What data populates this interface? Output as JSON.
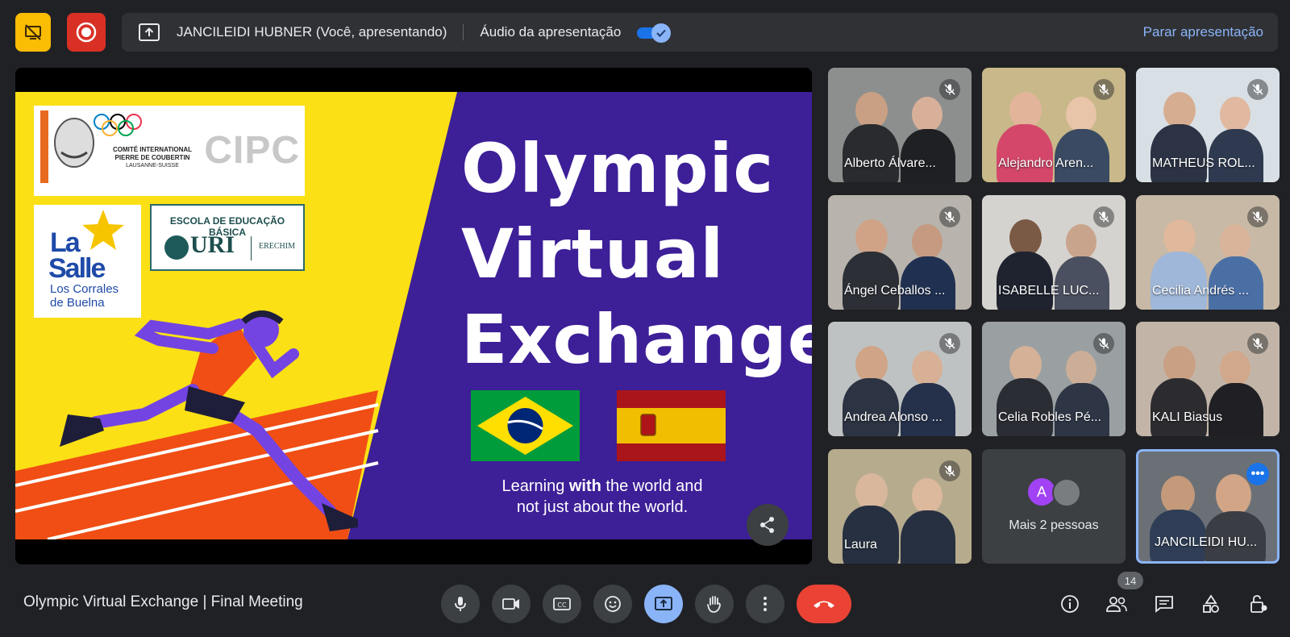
{
  "top_bar": {
    "stop_share_icon": "screen-share-off-icon",
    "record_icon": "record-icon",
    "presenter_text": "JANCILEIDI HUBNER (Você, apresentando)",
    "audio_label": "Áudio da apresentação",
    "audio_toggle_on": true,
    "stop_presenting_label": "Parar apresentação",
    "colors": {
      "stop_share_bg": "#fbbc04",
      "record_bg": "#d93025",
      "link": "#8ab4f8"
    }
  },
  "slide": {
    "title_lines": [
      "Olympic",
      "Virtual",
      "Exchange"
    ],
    "caption_pre": "Learning ",
    "caption_bold": "with",
    "caption_post": " the world and",
    "caption_line2": "not just about the world.",
    "cipc": {
      "letters": "CIPC",
      "line1": "COMITÉ INTERNATIONAL",
      "line2": "PIERRE DE COUBERTIN",
      "line3": "LAUSANNE-SUISSE"
    },
    "lasalle": {
      "la": "La",
      "salle": "Salle",
      "sub1": "Los Corrales",
      "sub2": "de Buelna"
    },
    "uri": {
      "school": "ESCOLA DE EDUCAÇÃO BÁSICA",
      "main": "URI",
      "city": "ERECHIM"
    },
    "colors": {
      "yellow": "#fbe016",
      "purple": "#3d1f97",
      "track": "#f04e14",
      "runner": "#7444e2"
    }
  },
  "participants": [
    {
      "name": "Alberto Álvare...",
      "muted": true
    },
    {
      "name": "Alejandro Aren...",
      "muted": true
    },
    {
      "name": "MATHEUS ROL...",
      "muted": true
    },
    {
      "name": "Ángel Ceballos ...",
      "muted": true
    },
    {
      "name": "ISABELLE LUC...",
      "muted": true
    },
    {
      "name": "Cecilia Andrés ...",
      "muted": true
    },
    {
      "name": "Andrea Alonso ...",
      "muted": true
    },
    {
      "name": "Celia Robles Pé...",
      "muted": true
    },
    {
      "name": "KALI Biasus",
      "muted": true
    },
    {
      "name": "Laura",
      "muted": true
    }
  ],
  "more_people": {
    "avatar_letter": "A",
    "label": "Mais 2 pessoas"
  },
  "self": {
    "name": "JANCILEIDI HU...",
    "menu": "•••"
  },
  "bottom_bar": {
    "meeting_title": "Olympic Virtual Exchange | Final Meeting",
    "controls": [
      "mic-icon",
      "camera-icon",
      "captions-icon",
      "emoji-icon",
      "present-icon",
      "raise-hand-icon",
      "more-options-icon",
      "hang-up-icon"
    ],
    "people_count": "14",
    "right_controls": [
      "info-icon",
      "people-icon",
      "chat-icon",
      "activities-icon",
      "host-controls-icon"
    ]
  }
}
